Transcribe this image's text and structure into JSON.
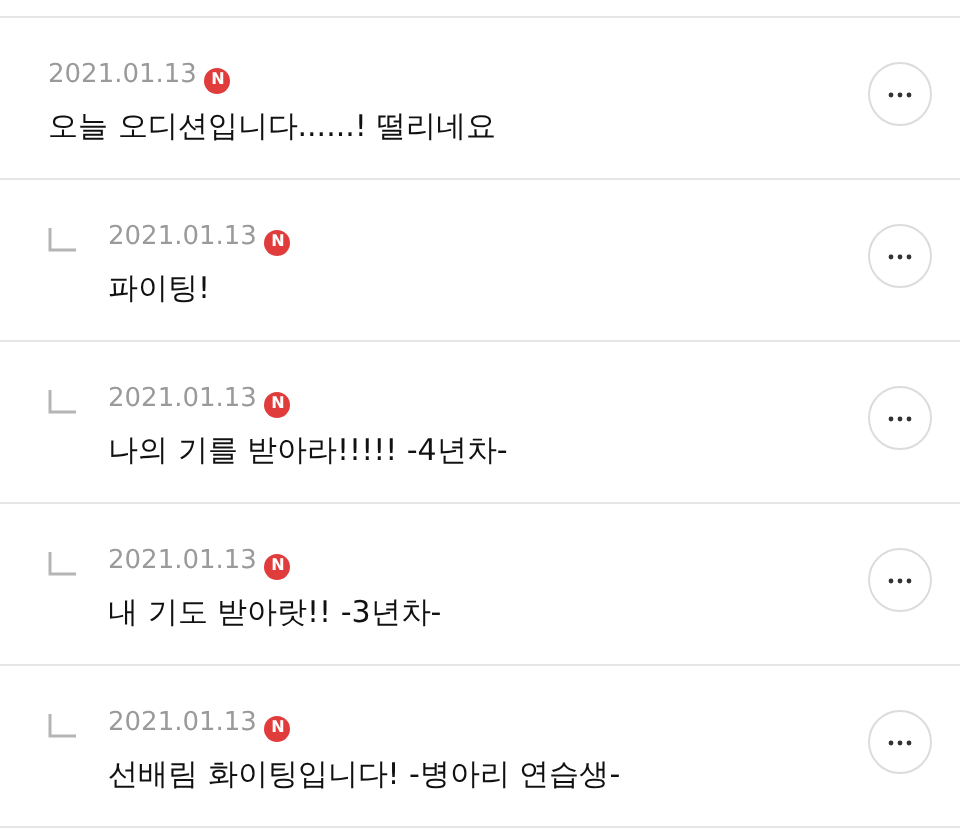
{
  "comments": [
    {
      "is_reply": false,
      "date": "2021.01.13",
      "badge": "N",
      "text": "오늘 오디션입니다......! 떨리네요"
    },
    {
      "is_reply": true,
      "date": "2021.01.13",
      "badge": "N",
      "text": "파이팅!"
    },
    {
      "is_reply": true,
      "date": "2021.01.13",
      "badge": "N",
      "text": "나의 기를 받아라!!!!! -4년차-"
    },
    {
      "is_reply": true,
      "date": "2021.01.13",
      "badge": "N",
      "text": "내 기도 받아랏!! -3년차-"
    },
    {
      "is_reply": true,
      "date": "2021.01.13",
      "badge": "N",
      "text": "선배림 화이팅입니다! -병아리 연습생-"
    }
  ]
}
